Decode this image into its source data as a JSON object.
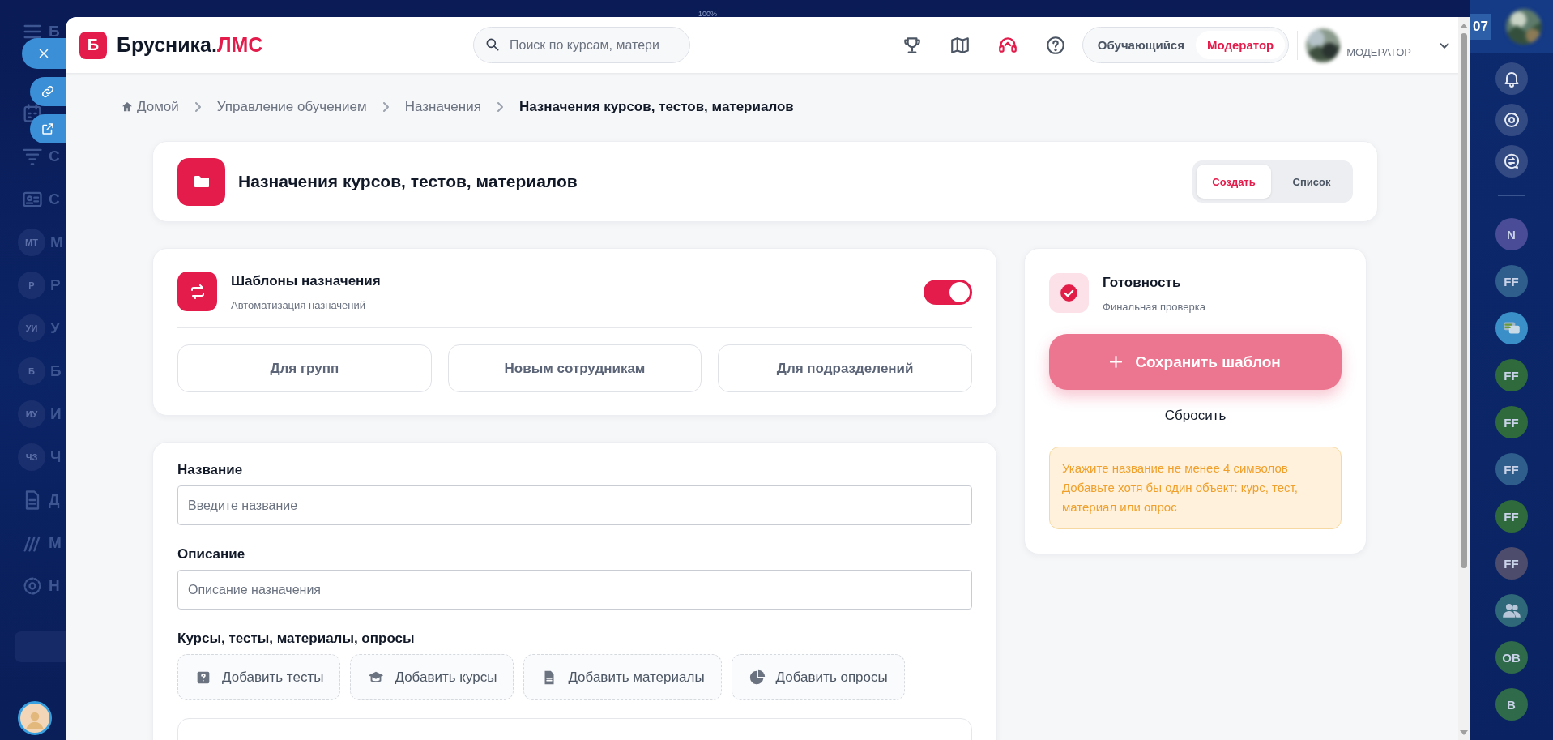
{
  "browser_zoom": "100%",
  "portal_sidebar": {
    "header_letter": "Б",
    "items": [
      {
        "kind": "icon"
      },
      {
        "kind": "icon",
        "label": "С"
      },
      {
        "kind": "icon",
        "label": "С"
      },
      {
        "kind": "badge",
        "badge": "МТ",
        "label": "М"
      },
      {
        "kind": "badge",
        "badge": "Р",
        "label": "Р"
      },
      {
        "kind": "badge",
        "badge": "УИ",
        "label": "У"
      },
      {
        "kind": "badge",
        "badge": "Б",
        "label": "Б"
      },
      {
        "kind": "badge",
        "badge": "ИУ",
        "label": "И"
      },
      {
        "kind": "badge",
        "badge": "ЧЗ",
        "label": "Ч"
      },
      {
        "kind": "icon",
        "label": "Д"
      },
      {
        "kind": "icon",
        "label": "М"
      },
      {
        "kind": "icon",
        "label": "Н"
      }
    ]
  },
  "right_strip": {
    "counter": "07",
    "contacts": [
      {
        "kind": "initials",
        "initials": "N",
        "color": "#4a4c98"
      },
      {
        "kind": "initials",
        "initials": "FF",
        "color": "#2f5d8c"
      },
      {
        "kind": "chat",
        "color": "#3b8fc9"
      },
      {
        "kind": "initials",
        "initials": "FF",
        "color": "#2f6a3c"
      },
      {
        "kind": "initials",
        "initials": "FF",
        "color": "#2f6a3c"
      },
      {
        "kind": "initials",
        "initials": "FF",
        "color": "#2f5d8c"
      },
      {
        "kind": "initials",
        "initials": "FF",
        "color": "#2f6a3c"
      },
      {
        "kind": "initials",
        "initials": "FF",
        "color": "#4d4c6c"
      },
      {
        "kind": "group",
        "color": "#2f6878"
      },
      {
        "kind": "initials",
        "initials": "OB",
        "color": "#2f6a4a"
      },
      {
        "kind": "initials",
        "initials": "B",
        "color": "#2f6a4a"
      }
    ]
  },
  "header": {
    "logo_letter": "Б",
    "brand": "Брусника.",
    "brand_accent": "ЛМС",
    "search": {
      "placeholder": "Поиск по курсам, матери"
    },
    "role_switch": [
      {
        "label": "Обучающийся",
        "selected": false
      },
      {
        "label": "Модератор",
        "selected": true
      }
    ],
    "user": {
      "role": "МОДЕРАТОР"
    }
  },
  "breadcrumbs": [
    "Домой",
    "Управление обучением",
    "Назначения",
    "Назначения курсов, тестов, материалов"
  ],
  "page_header": {
    "title": "Назначения курсов, тестов, материалов",
    "view_switch": [
      {
        "label": "Создать",
        "selected": true
      },
      {
        "label": "Список",
        "selected": false
      }
    ]
  },
  "templates": {
    "title": "Шаблоны назначения",
    "subtitle": "Автоматизация назначений",
    "on": true,
    "options": [
      "Для групп",
      "Новым сотрудникам",
      "Для подразделений"
    ]
  },
  "form": {
    "fields": [
      {
        "label": "Название",
        "placeholder": "Введите название"
      },
      {
        "label": "Описание",
        "placeholder": "Описание назначения"
      }
    ],
    "objects_label": "Курсы, тесты, материалы, опросы",
    "add_buttons": [
      "Добавить тесты",
      "Добавить курсы",
      "Добавить материалы",
      "Добавить опросы"
    ]
  },
  "readiness": {
    "title": "Готовность",
    "subtitle": "Финальная проверка",
    "save_button": {
      "label": "Сохранить шаблон",
      "disabled": true
    },
    "reset": "Сбросить",
    "warnings": [
      "Укажите название не менее 4 символов",
      "Добавьте хотя бы один объект: курс, тест, материал или опрос"
    ]
  }
}
